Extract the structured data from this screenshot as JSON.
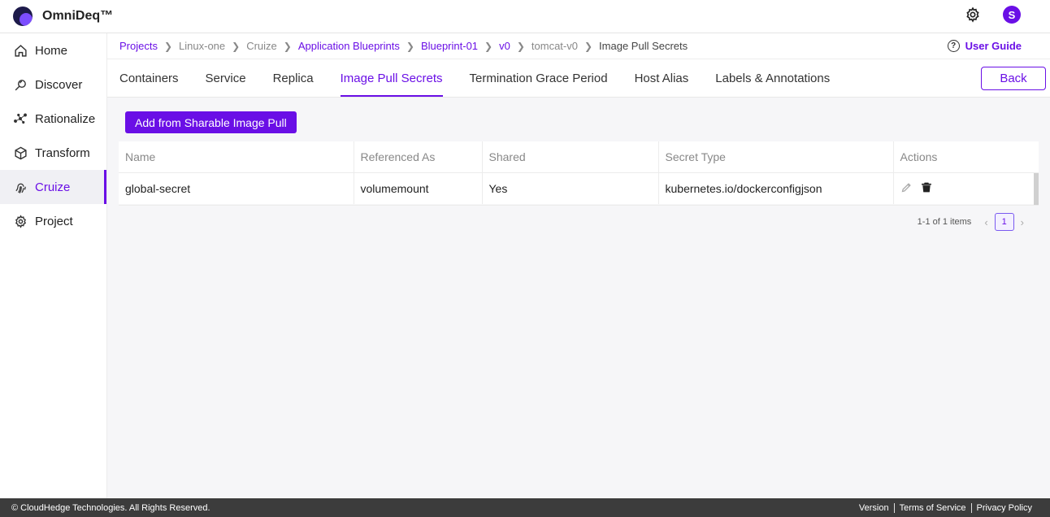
{
  "app": {
    "name": "OmniDeq™",
    "avatar_letter": "S",
    "accent": "#6a0fe6"
  },
  "sidebar": {
    "items": [
      {
        "label": "Home",
        "icon": "home-icon"
      },
      {
        "label": "Discover",
        "icon": "discover-icon"
      },
      {
        "label": "Rationalize",
        "icon": "rationalize-icon"
      },
      {
        "label": "Transform",
        "icon": "cube-icon"
      },
      {
        "label": "Cruize",
        "icon": "fingerprint-icon",
        "active": true
      },
      {
        "label": "Project",
        "icon": "gear-icon"
      }
    ]
  },
  "breadcrumb": [
    "Projects",
    "Linux-one",
    "Cruize",
    "Application Blueprints",
    "Blueprint-01",
    "v0",
    "tomcat-v0",
    "Image Pull Secrets"
  ],
  "user_guide": "User Guide",
  "tabs": [
    "Containers",
    "Service",
    "Replica",
    "Image Pull Secrets",
    "Termination Grace Period",
    "Host Alias",
    "Labels & Annotations"
  ],
  "active_tab": "Image Pull Secrets",
  "back_label": "Back",
  "add_button": "Add from Sharable Image Pull",
  "table": {
    "columns": [
      "Name",
      "Referenced As",
      "Shared",
      "Secret Type",
      "Actions"
    ],
    "rows": [
      {
        "name": "global-secret",
        "referenced_as": "volumemount",
        "shared": "Yes",
        "secret_type": "kubernetes.io/dockerconfigjson"
      }
    ]
  },
  "pagination": {
    "info": "1-1 of 1 items",
    "current_page": "1"
  },
  "footer": {
    "copyright": "© CloudHedge Technologies. All Rights Reserved.",
    "links": [
      "Version",
      "Terms of Service",
      "Privacy Policy"
    ]
  }
}
